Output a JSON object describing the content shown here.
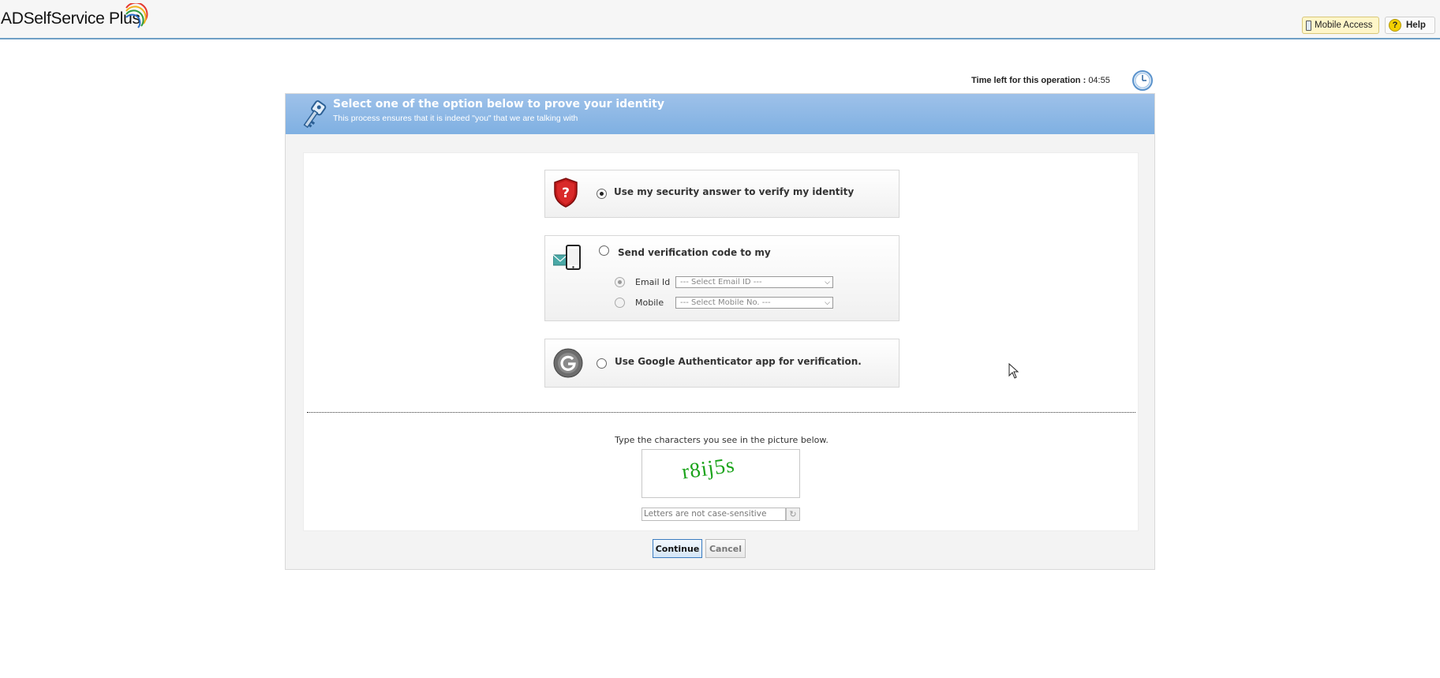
{
  "header": {
    "logo_text": "ADSelfService",
    "logo_plus": " Plus",
    "mobile_access_label": "Mobile Access",
    "help_label": "Help"
  },
  "timer": {
    "label": "Time left for this operation : ",
    "value": "04:55"
  },
  "panel": {
    "title": "Select one of the option below to prove your identity",
    "subtitle": "This process ensures that it is indeed \"you\" that we are talking with"
  },
  "options": [
    {
      "label": "Use my security answer to verify my identity",
      "selected": true,
      "icon": "security-question-shield-icon"
    },
    {
      "label": "Send verification code to my",
      "selected": false,
      "icon": "email-mobile-icon",
      "sub_options": [
        {
          "label": "Email Id",
          "selected": true,
          "select_placeholder": "--- Select Email ID ---"
        },
        {
          "label": "Mobile",
          "selected": false,
          "select_placeholder": "--- Select Mobile No. ---"
        }
      ]
    },
    {
      "label": "Use Google Authenticator app for verification.",
      "selected": false,
      "icon": "google-authenticator-icon"
    }
  ],
  "captcha": {
    "hint": "Type the characters you see in the picture below.",
    "image_text": "r8ij5s",
    "input_placeholder": "Letters are not case-sensitive"
  },
  "buttons": {
    "continue": "Continue",
    "cancel": "Cancel"
  },
  "colors": {
    "header_blue": "#7fb0e2",
    "accent_border": "#6f9fc5",
    "captcha_green": "#1aa31a"
  }
}
